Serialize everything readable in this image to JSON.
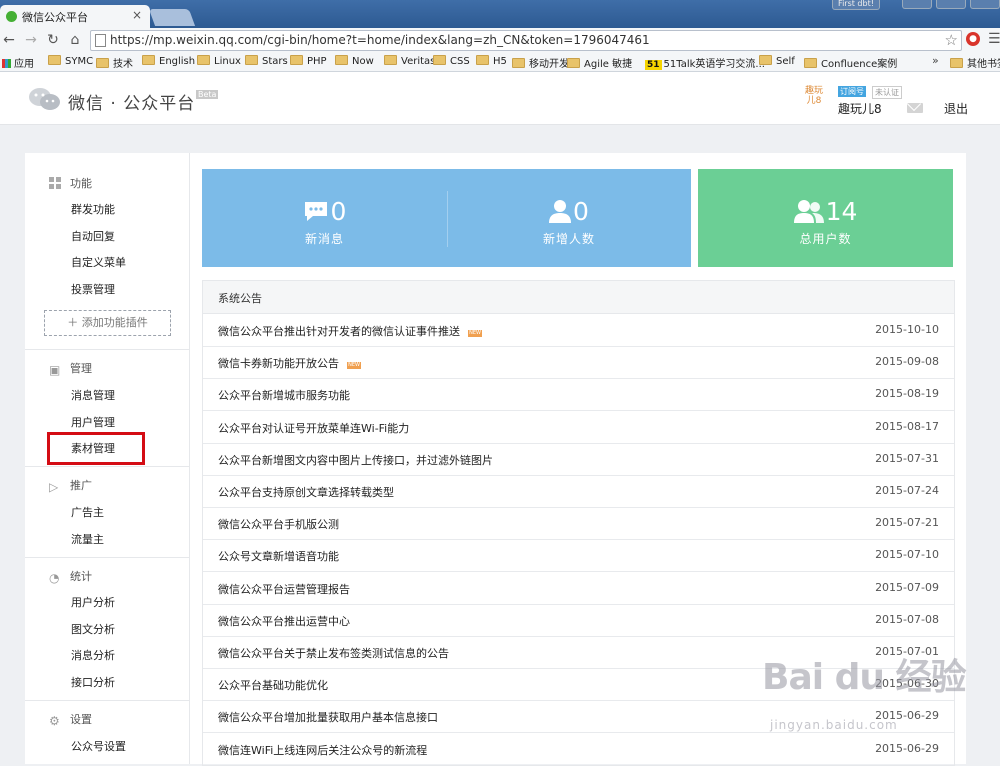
{
  "browser": {
    "tab_title": "微信公众平台",
    "tab_close": "×",
    "user_badge": "First dbt!",
    "url": "https://mp.weixin.qq.com/cgi-bin/home?t=home/index&lang=zh_CN&token=1796047461",
    "bookmarks": [
      {
        "label": "应用",
        "icon": "apps-icon"
      },
      {
        "label": "SYMC",
        "icon": "folder-icon"
      },
      {
        "label": "技术",
        "icon": "folder-icon"
      },
      {
        "label": "English",
        "icon": "folder-icon"
      },
      {
        "label": "Linux",
        "icon": "folder-icon"
      },
      {
        "label": "Stars",
        "icon": "folder-icon"
      },
      {
        "label": "PHP",
        "icon": "folder-icon"
      },
      {
        "label": "Now",
        "icon": "folder-icon"
      },
      {
        "label": "Veritas",
        "icon": "folder-icon"
      },
      {
        "label": "CSS",
        "icon": "folder-icon"
      },
      {
        "label": "H5",
        "icon": "folder-icon"
      },
      {
        "label": "移动开发",
        "icon": "folder-icon"
      },
      {
        "label": "Agile 敏捷",
        "icon": "folder-icon"
      },
      {
        "label": "51Talk英语学习交流...",
        "icon": "51talk-icon",
        "badge": "51"
      },
      {
        "label": "Self",
        "icon": "folder-icon"
      },
      {
        "label": "Confluence案例",
        "icon": "folder-icon"
      }
    ],
    "more_bookmarks": "»",
    "other_bookmarks": "其他书签"
  },
  "header": {
    "brand": "微信 · 公众平台",
    "beta": "Beta",
    "avatar_text": "趣玩儿8",
    "account_tag": "订阅号",
    "account_tag2": "未认证",
    "account_name": "趣玩儿8",
    "logout": "退出"
  },
  "sidebar": {
    "sections": [
      {
        "title": "功能",
        "icon": "grid-icon",
        "items": [
          "群发功能",
          "自动回复",
          "自定义菜单",
          "投票管理"
        ]
      },
      {
        "title": "管理",
        "icon": "inbox-icon",
        "items": [
          "消息管理",
          "用户管理",
          "素材管理"
        ]
      },
      {
        "title": "推广",
        "icon": "megaphone-icon",
        "items": [
          "广告主",
          "流量主"
        ]
      },
      {
        "title": "统计",
        "icon": "pie-chart-icon",
        "items": [
          "用户分析",
          "图文分析",
          "消息分析",
          "接口分析"
        ]
      },
      {
        "title": "设置",
        "icon": "gear-icon",
        "items": [
          "公众号设置"
        ]
      }
    ],
    "add_plugin": "＋ 添加功能插件",
    "highlighted_item": "素材管理"
  },
  "stats": [
    {
      "value": "0",
      "label": "新消息",
      "icon": "message-icon"
    },
    {
      "value": "0",
      "label": "新增人数",
      "icon": "user-icon"
    },
    {
      "value": "14",
      "label": "总用户数",
      "icon": "users-icon"
    }
  ],
  "notices": {
    "heading": "系统公告",
    "rows": [
      {
        "title": "微信公众平台推出针对开发者的微信认证事件推送",
        "new": true,
        "date": "2015-10-10"
      },
      {
        "title": "微信卡券新功能开放公告",
        "new": true,
        "date": "2015-09-08"
      },
      {
        "title": "公众平台新增城市服务功能",
        "new": false,
        "date": "2015-08-19"
      },
      {
        "title": "公众平台对认证号开放菜单连Wi-Fi能力",
        "new": false,
        "date": "2015-08-17"
      },
      {
        "title": "公众平台新增图文内容中图片上传接口，并过滤外链图片",
        "new": false,
        "date": "2015-07-31"
      },
      {
        "title": "公众平台支持原创文章选择转载类型",
        "new": false,
        "date": "2015-07-24"
      },
      {
        "title": "微信公众平台手机版公测",
        "new": false,
        "date": "2015-07-21"
      },
      {
        "title": "公众号文章新增语音功能",
        "new": false,
        "date": "2015-07-10"
      },
      {
        "title": "微信公众平台运营管理报告",
        "new": false,
        "date": "2015-07-09"
      },
      {
        "title": "微信公众平台推出运营中心",
        "new": false,
        "date": "2015-07-08"
      },
      {
        "title": "微信公众平台关于禁止发布签类测试信息的公告",
        "new": false,
        "date": "2015-07-01"
      },
      {
        "title": "公众平台基础功能优化",
        "new": false,
        "date": "2015-06-30"
      },
      {
        "title": "微信公众平台增加批量获取用户基本信息接口",
        "new": false,
        "date": "2015-06-29"
      },
      {
        "title": "微信连WiFi上线连网后关注公众号的新流程",
        "new": false,
        "date": "2015-06-29"
      }
    ],
    "new_badge": "NEW"
  },
  "watermark": {
    "main": "Bai  du 经验",
    "sub": "jingyan.baidu.com"
  },
  "colors": {
    "stat_blue": "#7cbbe8",
    "stat_green": "#6bcf95",
    "highlight": "#d40c14"
  }
}
